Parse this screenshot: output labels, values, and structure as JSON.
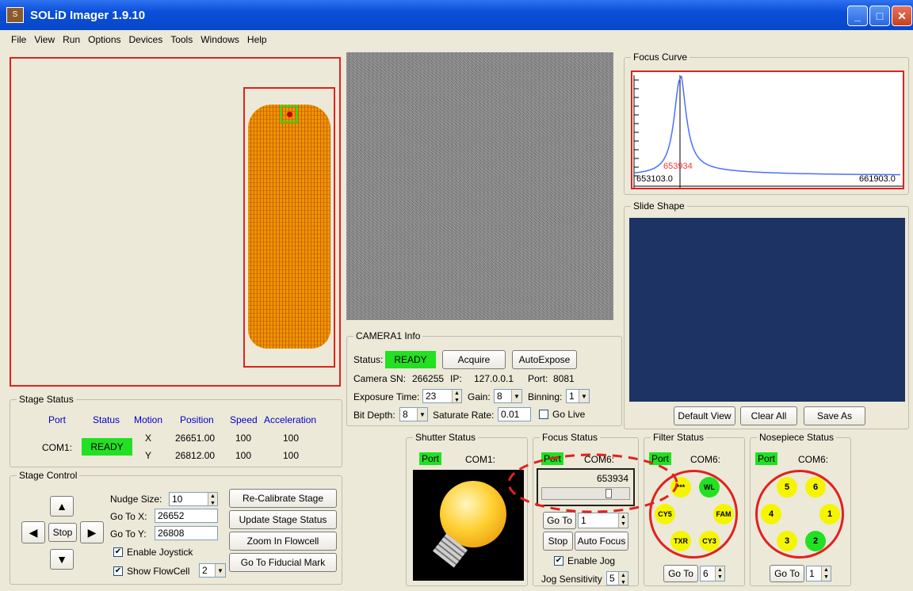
{
  "window": {
    "title": "SOLiD Imager 1.9.10",
    "icon": "app-icon",
    "buttons": [
      "minimize-icon",
      "maximize-icon",
      "close-icon"
    ]
  },
  "menu": [
    "File",
    "View",
    "Run",
    "Options",
    "Devices",
    "Tools",
    "Windows",
    "Help"
  ],
  "focus_curve": {
    "title": "Focus Curve",
    "min_label": "653103.0",
    "max_label": "661903.0",
    "peak_label": "653934",
    "chart_data": {
      "type": "line",
      "x_range": [
        653103.0,
        661903.0
      ],
      "peak_x": 653934,
      "peak_color": "#ff3333",
      "line_color": "#4a6fff"
    }
  },
  "slide_shape": {
    "title": "Slide Shape",
    "buttons": [
      "Default View",
      "Clear All",
      "Save As"
    ]
  },
  "camera": {
    "title": "CAMERA1 Info",
    "status_label": "Status:",
    "status": "READY",
    "acquire": "Acquire",
    "autoexpose": "AutoExpose",
    "sn_label": "Camera SN:",
    "sn": "266255",
    "ip_label": "IP:",
    "ip": "127.0.0.1",
    "port_label": "Port:",
    "port": "8081",
    "exposure_label": "Exposure Time:",
    "exposure": "23",
    "gain_label": "Gain:",
    "gain": "8",
    "binning_label": "Binning:",
    "binning": "1",
    "bitdepth_label": "Bit Depth:",
    "bitdepth": "8",
    "saturate_label": "Saturate Rate:",
    "saturate": "0.01",
    "golive": "Go Live"
  },
  "stage_status": {
    "title": "Stage Status",
    "headers": [
      "Port",
      "Status",
      "Motion",
      "Position",
      "Speed",
      "Acceleration"
    ],
    "port": "COM1:",
    "status": "READY",
    "rows": [
      {
        "axis": "X",
        "position": "26651.00",
        "speed": "100",
        "accel": "100"
      },
      {
        "axis": "Y",
        "position": "26812.00",
        "speed": "100",
        "accel": "100"
      }
    ]
  },
  "stage_control": {
    "title": "Stage Control",
    "stop": "Stop",
    "nudge_label": "Nudge Size:",
    "nudge": "10",
    "gotox_label": "Go To X:",
    "gotox": "26652",
    "gotoy_label": "Go To Y:",
    "gotoy": "26808",
    "joystick": "Enable Joystick",
    "flowcell": "Show FlowCell",
    "flowcell_val": "2",
    "buttons": [
      "Re-Calibrate Stage",
      "Update Stage Status",
      "Zoom In Flowcell",
      "Go To Fiducial Mark"
    ]
  },
  "shutter": {
    "title": "Shutter Status",
    "port": "Port",
    "com": "COM1:"
  },
  "focus": {
    "title": "Focus Status",
    "port": "Port",
    "com": "COM6:",
    "value": "653934",
    "goto": "Go To",
    "goto_val": "1",
    "stop": "Stop",
    "autofocus": "Auto Focus",
    "jog": "Enable Jog",
    "jog_sens_label": "Jog Sensitivity",
    "jog_sens": "5"
  },
  "filter": {
    "title": "Filter Status",
    "port": "Port",
    "com": "COM6:",
    "positions": [
      "***",
      "WL",
      "FAM",
      "CY3",
      "TXR",
      "CY5"
    ],
    "goto": "Go To",
    "goto_val": "6"
  },
  "nosepiece": {
    "title": "Nosepiece Status",
    "port": "Port",
    "com": "COM6:",
    "positions": [
      "6",
      "1",
      "2",
      "3",
      "4",
      "5"
    ],
    "goto": "Go To",
    "goto_val": "1"
  },
  "colors": {
    "ready": "#22e022",
    "highlight_red": "#e0221e",
    "slide_bg": "#1c3364",
    "flowcell": "#f5c400"
  }
}
